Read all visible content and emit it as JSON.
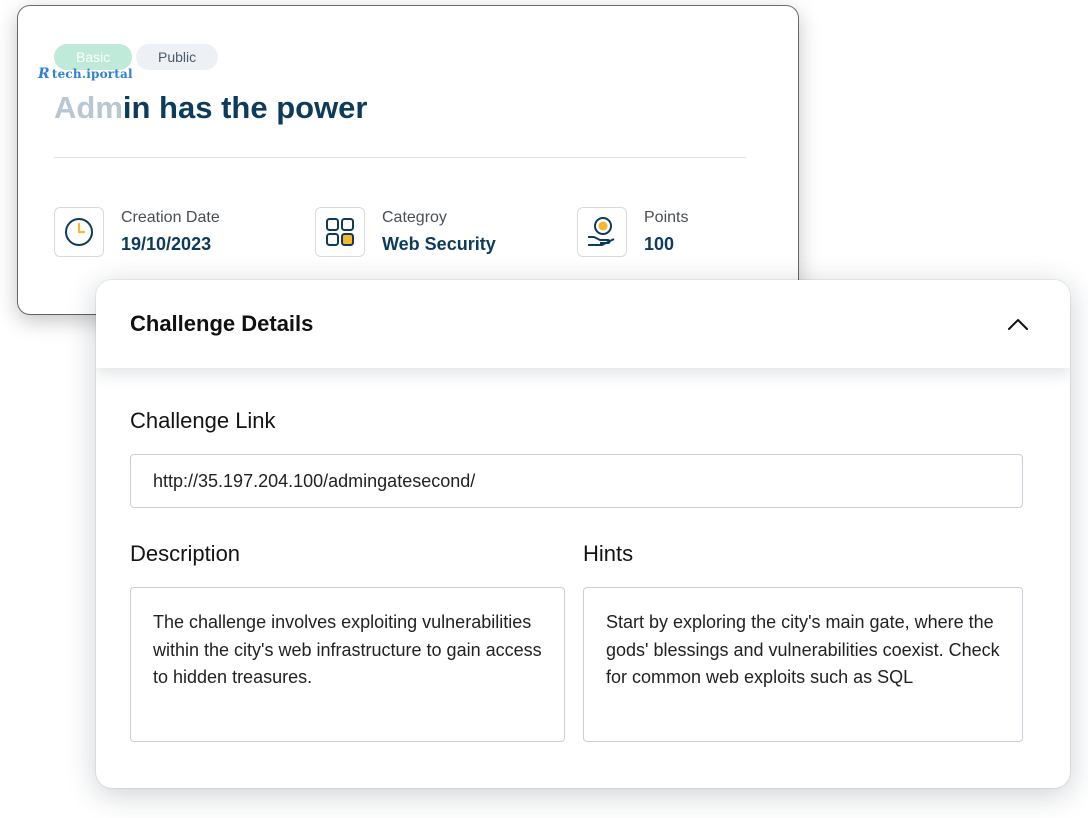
{
  "challenge": {
    "tags": [
      "Basic",
      "Public"
    ],
    "watermark": "tech.iportal",
    "title_faded": "Adm",
    "title_rest": "in has the power"
  },
  "meta": [
    {
      "label": "Creation Date",
      "value": "19/10/2023",
      "icon": "clock-icon"
    },
    {
      "label": "Categroy",
      "value": "Web Security",
      "icon": "category-grid-icon"
    },
    {
      "label": "Points",
      "value": "100",
      "icon": "coin-hand-icon"
    }
  ],
  "details": {
    "header": "Challenge Details",
    "collapse_icon": "chevron-up-icon",
    "link_label": "Challenge Link",
    "link_value": "http://35.197.204.100/admingatesecond/",
    "description_label": "Description",
    "description_text": "The challenge involves exploiting vulnerabilities within the city's web infrastructure to gain access to hidden treasures.",
    "hints_label": "Hints",
    "hints_text": "Start by exploring the city's main gate, where the gods' blessings and vulnerabilities coexist. Check for common web exploits such as SQL"
  },
  "colors": {
    "title": "#0d3b5c",
    "basic_tag": "#bfe9d9",
    "public_tag": "#edf1f5",
    "category_accent": "#f5b82e",
    "coin_accent": "#f5b82e"
  }
}
